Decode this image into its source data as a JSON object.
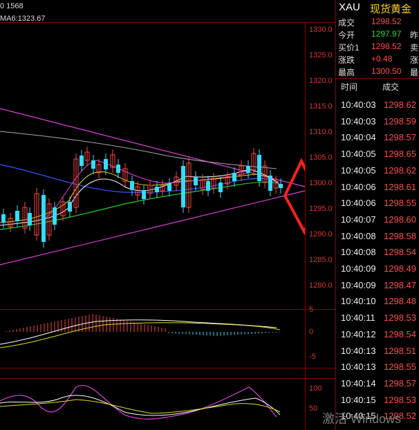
{
  "chart": {
    "top_label": "0 1568",
    "ma_label": "MA6:1323.67",
    "price_ticks": [
      "1330.0",
      "1325.0",
      "1320.0",
      "1315.0",
      "1310.0",
      "1305.0",
      "1300.0",
      "1295.0",
      "1290.0",
      "1285.0",
      "1280.0"
    ],
    "macd_ticks": [
      "5",
      "0",
      "-5"
    ],
    "kdj_ticks": [
      "100",
      "50"
    ]
  },
  "quote": {
    "symbol": "XAU",
    "name": "现货黄金",
    "rows": [
      {
        "label": "成交",
        "value": "1298.52",
        "color": "#ff4d4d",
        "extra": ""
      },
      {
        "label": "今开",
        "value": "1297.97",
        "color": "#22dd22",
        "extra": "昨"
      },
      {
        "label": "买价1",
        "value": "1298.52",
        "color": "#ff4d4d",
        "extra": "卖"
      },
      {
        "label": "涨跌",
        "value": "+0.48",
        "color": "#ff4d4d",
        "extra": "涨"
      },
      {
        "label": "最高",
        "value": "1300.50",
        "color": "#ff4d4d",
        "extra": "最"
      }
    ],
    "ticks_header": {
      "time": "时间",
      "price": "成交"
    },
    "ticks": [
      {
        "time": "10:40:03",
        "price": "1298.62"
      },
      {
        "time": "10:40:03",
        "price": "1298.59"
      },
      {
        "time": "10:40:04",
        "price": "1298.57"
      },
      {
        "time": "10:40:05",
        "price": "1298.65"
      },
      {
        "time": "10:40:05",
        "price": "1298.62"
      },
      {
        "time": "10:40:06",
        "price": "1298.61"
      },
      {
        "time": "10:40:06",
        "price": "1298.55"
      },
      {
        "time": "10:40:07",
        "price": "1298.60"
      },
      {
        "time": "10:40:08",
        "price": "1298.58"
      },
      {
        "time": "10:40:08",
        "price": "1298.54"
      },
      {
        "time": "10:40:09",
        "price": "1298.49"
      },
      {
        "time": "10:40:09",
        "price": "1298.47"
      },
      {
        "time": "10:40:10",
        "price": "1298.48"
      },
      {
        "time": "10:40:11",
        "price": "1298.53"
      },
      {
        "time": "10:40:12",
        "price": "1298.54"
      },
      {
        "time": "10:40:13",
        "price": "1298.51"
      },
      {
        "time": "10:40:13",
        "price": "1298.55"
      },
      {
        "time": "10:40:14",
        "price": "1298.57"
      },
      {
        "time": "10:40:15",
        "price": "1298.53"
      },
      {
        "time": "10:40:15",
        "price": "1298.52"
      }
    ]
  },
  "watermark": "激活 Windows"
}
